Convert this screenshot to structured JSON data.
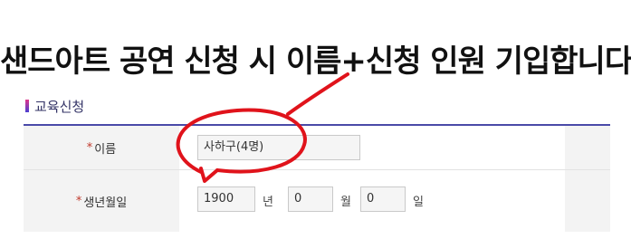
{
  "headline": "샌드아트 공연 신청 시 이름+신청 인원 기입합니다.",
  "section": {
    "title": "교육신청"
  },
  "form": {
    "name_row": {
      "required_mark": "*",
      "label": "이름",
      "value": "사하구(4명)"
    },
    "birth_row": {
      "required_mark": "*",
      "label": "생년월일",
      "year_value": "1900",
      "year_unit": "년",
      "month_value": "0",
      "month_unit": "월",
      "day_value": "0",
      "day_unit": "일"
    }
  },
  "colors": {
    "annotation": "#e0131b",
    "form_border": "#4a4aa8",
    "accent_gradient": [
      "#e0358a",
      "#4a3fd1"
    ]
  }
}
